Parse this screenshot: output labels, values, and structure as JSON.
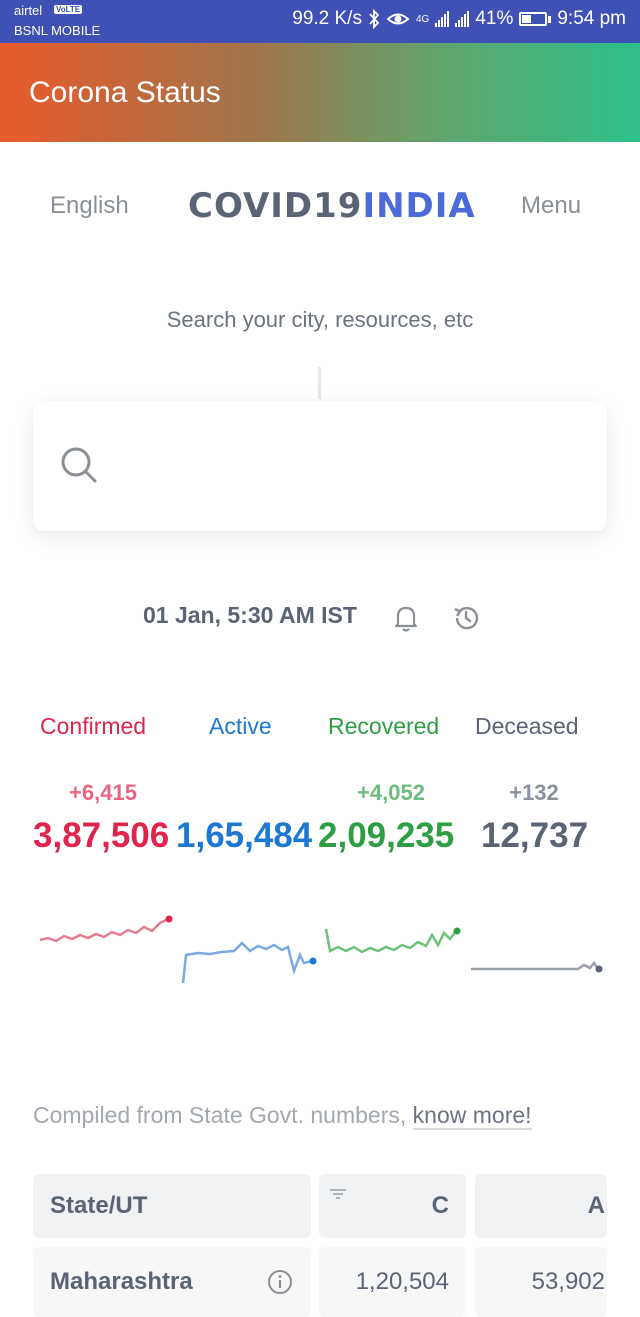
{
  "status_bar": {
    "carrier_primary": "airtel",
    "volte_badge": "VoLTE",
    "carrier_secondary": "BSNL MOBILE",
    "net_speed": "99.2 K/s",
    "network_type": "4G",
    "battery": "41%",
    "battery_level": 0.41,
    "time": "9:54 pm",
    "icons": [
      "bluetooth-icon",
      "eye-icon",
      "signal-icon",
      "battery-icon"
    ]
  },
  "app_bar": {
    "title": "Corona Status"
  },
  "nav": {
    "language": "English",
    "logo_part1": "COVID19",
    "logo_part2": "INDIA",
    "menu": "Menu"
  },
  "search": {
    "hint": "Search your city, resources, etc",
    "placeholder": ""
  },
  "update": {
    "timestamp": "01 Jan, 5:30 AM IST"
  },
  "stats": {
    "confirmed": {
      "label": "Confirmed",
      "delta": "+6,415",
      "value": "3,87,506",
      "color": "#e0244b"
    },
    "active": {
      "label": "Active",
      "delta": "",
      "value": "1,65,484",
      "color": "#1e78d2"
    },
    "recovered": {
      "label": "Recovered",
      "delta": "+4,052",
      "value": "2,09,235",
      "color": "#2e9e45"
    },
    "deceased": {
      "label": "Deceased",
      "delta": "+132",
      "value": "12,737",
      "color": "#5b6475"
    }
  },
  "compiled": {
    "text": "Compiled from State Govt. numbers, ",
    "link": "know more!"
  },
  "table": {
    "headers": [
      "State/UT",
      "C",
      "A"
    ],
    "rows": [
      {
        "state": "Maharashtra",
        "confirmed": "1,20,504",
        "active": "53,902"
      }
    ]
  }
}
